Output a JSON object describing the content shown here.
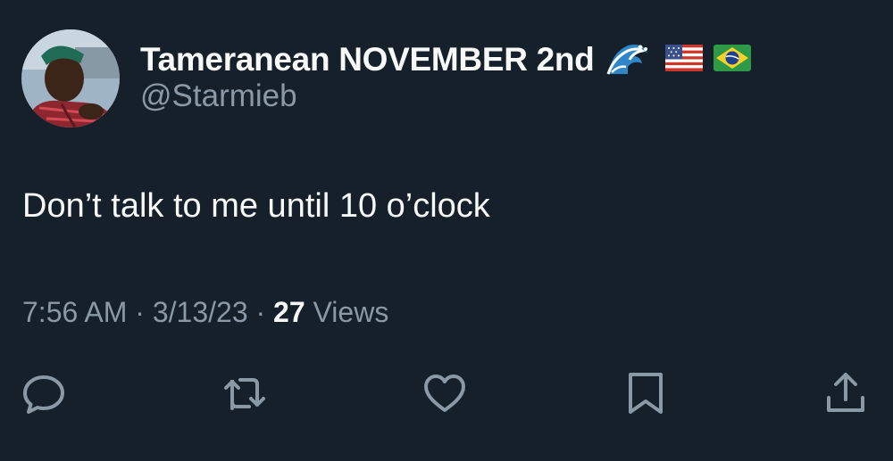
{
  "author": {
    "display_name": "Tameranean NOVEMBER 2nd",
    "name_emojis": [
      "water-wave-emoji",
      "us-flag-emoji",
      "brazil-flag-emoji"
    ],
    "handle": "@Starmieb"
  },
  "tweet": {
    "text": "Don’t talk to me until 10 o’clock",
    "time": "7:56 AM",
    "date": "3/13/23",
    "separator": "·",
    "views_count": "27",
    "views_label": "Views"
  },
  "actions": [
    "reply-icon",
    "retweet-icon",
    "like-icon",
    "bookmark-icon",
    "share-icon"
  ],
  "colors": {
    "background": "#15202b",
    "text_primary": "#f7f9f9",
    "text_secondary": "#8b98a5",
    "icon": "#8b98a5"
  }
}
